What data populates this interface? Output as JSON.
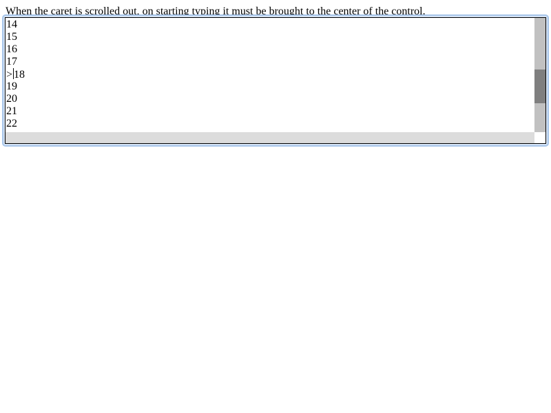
{
  "instruction": "When the caret is scrolled out, on starting typing it must be brought to the center of the control.",
  "textarea": {
    "lines": [
      "14",
      "15",
      "16",
      "17",
      ">18",
      "19",
      "20",
      "21",
      "22"
    ],
    "caret_line_index": 4,
    "caret_after_text": ">"
  },
  "scrollbar": {
    "vertical_thumb_position_fraction": 0.45,
    "horizontal_visible": true
  },
  "colors": {
    "focus_ring": "#a8c6ea",
    "scroll_track": "#c1c1c1",
    "scroll_thumb": "#7f7f7f",
    "hscroll_track": "#dcdcdc"
  }
}
